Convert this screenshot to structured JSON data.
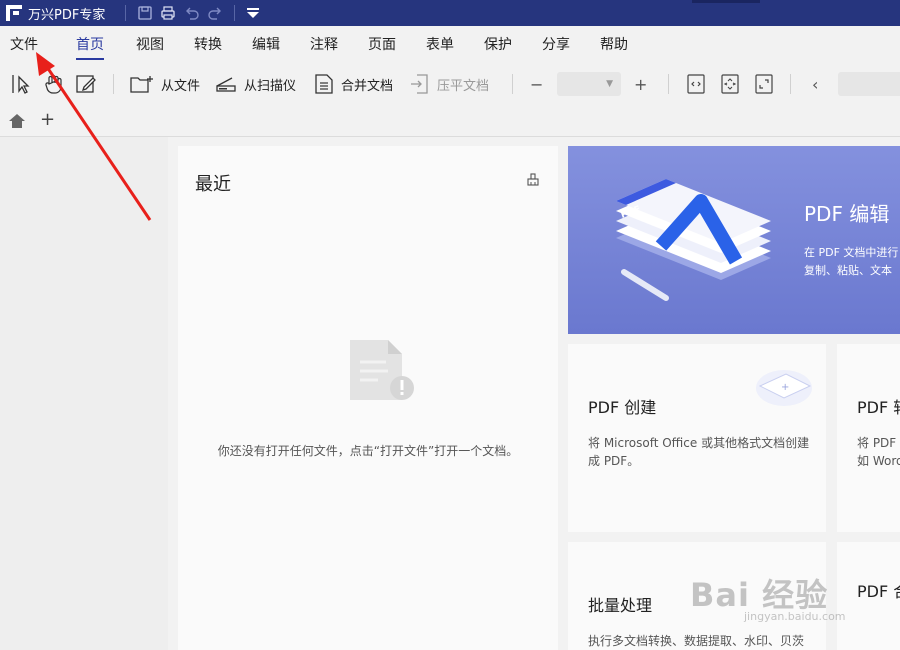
{
  "window": {
    "title": "万兴PDF专家"
  },
  "menu": {
    "items": [
      "文件",
      "首页",
      "视图",
      "转换",
      "编辑",
      "注释",
      "页面",
      "表单",
      "保护",
      "分享",
      "帮助"
    ],
    "active": "首页"
  },
  "toolbar": {
    "from_file": "从文件",
    "from_scanner": "从扫描仪",
    "merge_docs": "合并文档",
    "flatten_docs": "压平文档",
    "zoom_out": "−",
    "zoom_in": "+",
    "prev": "‹"
  },
  "tabs": {
    "add": "+"
  },
  "recent": {
    "title": "最近",
    "empty_message": "你还没有打开任何文件，点击“打开文件”打开一个文档。"
  },
  "hero": {
    "title": "PDF 编辑",
    "desc_line1": "在 PDF 文档中进行",
    "desc_line2": "复制、粘贴、文本"
  },
  "cards": {
    "create": {
      "title": "PDF 创建",
      "desc_line1": "将 Microsoft Office 或其他格式文档创建",
      "desc_line2": "成 PDF。"
    },
    "convert": {
      "title": "PDF 转",
      "desc_line1": "将 PDF 转",
      "desc_line2": "如 Word"
    },
    "batch": {
      "title": "批量处理",
      "desc_line1": "执行多文档转换、数据提取、水印、贝茨"
    },
    "combine": {
      "title": "PDF 合"
    }
  },
  "watermark": {
    "brand": "Bai 经验",
    "url": "jingyan.baidu.com"
  },
  "colors": {
    "titlebar": "#26357e",
    "accent": "#2a3aa0",
    "hero": "#7481d6",
    "arrow": "#e8201b"
  }
}
